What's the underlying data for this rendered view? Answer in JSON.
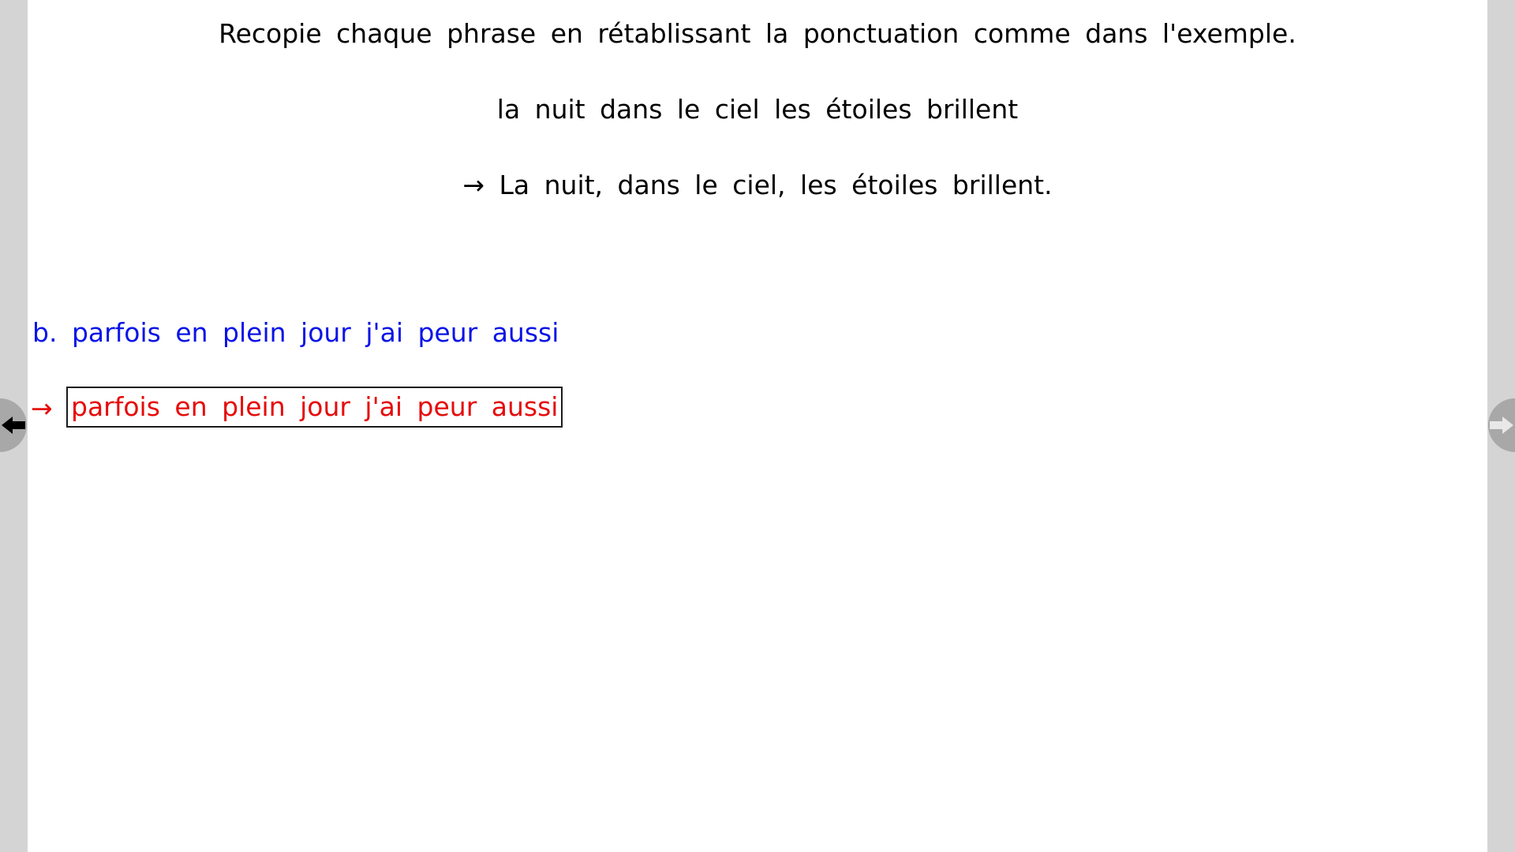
{
  "exercise": {
    "instruction": "Recopie chaque phrase en rétablissant la ponctuation comme dans l'exemple.",
    "example_sentence": "la nuit dans le ciel les étoiles brillent",
    "example_answer": "→ La nuit, dans le ciel, les étoiles brillent.",
    "item_label": "b.",
    "item_sentence": "parfois en plein jour j'ai peur aussi",
    "answer_arrow": "→",
    "answer_value": "parfois en plein jour j'ai peur aussi"
  },
  "navigation": {
    "prev_icon": "arrow-left-icon",
    "next_icon": "arrow-right-icon"
  },
  "colors": {
    "background": "#d4d4d4",
    "page": "#ffffff",
    "text": "#000000",
    "exercise_text": "#0a14e6",
    "answer_text": "#e60a0a",
    "nav_button": "#a8a8a8"
  }
}
